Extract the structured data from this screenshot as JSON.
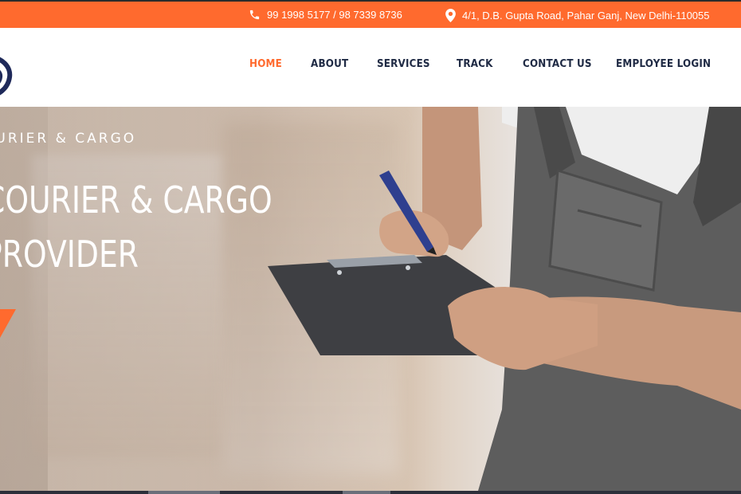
{
  "topbar": {
    "phone": "99 1998 5177 / 98 7339 8736",
    "address": "4/1, D.B. Gupta Road, Pahar Ganj, New Delhi-110055",
    "bg_color": "#ff6a2e",
    "icons": {
      "phone": "phone-icon",
      "address": "location-pin-icon"
    }
  },
  "nav": {
    "items": [
      {
        "label": "HOME",
        "active": true
      },
      {
        "label": "ABOUT",
        "active": false
      },
      {
        "label": "SERVICES",
        "active": false
      },
      {
        "label": "TRACK",
        "active": false
      },
      {
        "label": "CONTACT US",
        "active": false
      },
      {
        "label": "EMPLOYEE LOGIN",
        "active": false
      }
    ],
    "active_color": "#ff6a2e",
    "text_color": "#1f2a44"
  },
  "hero": {
    "eyebrow": "OURIER & CARGO",
    "headline_line1": "COURIER & CARGO",
    "headline_line2": "PROVIDER"
  }
}
